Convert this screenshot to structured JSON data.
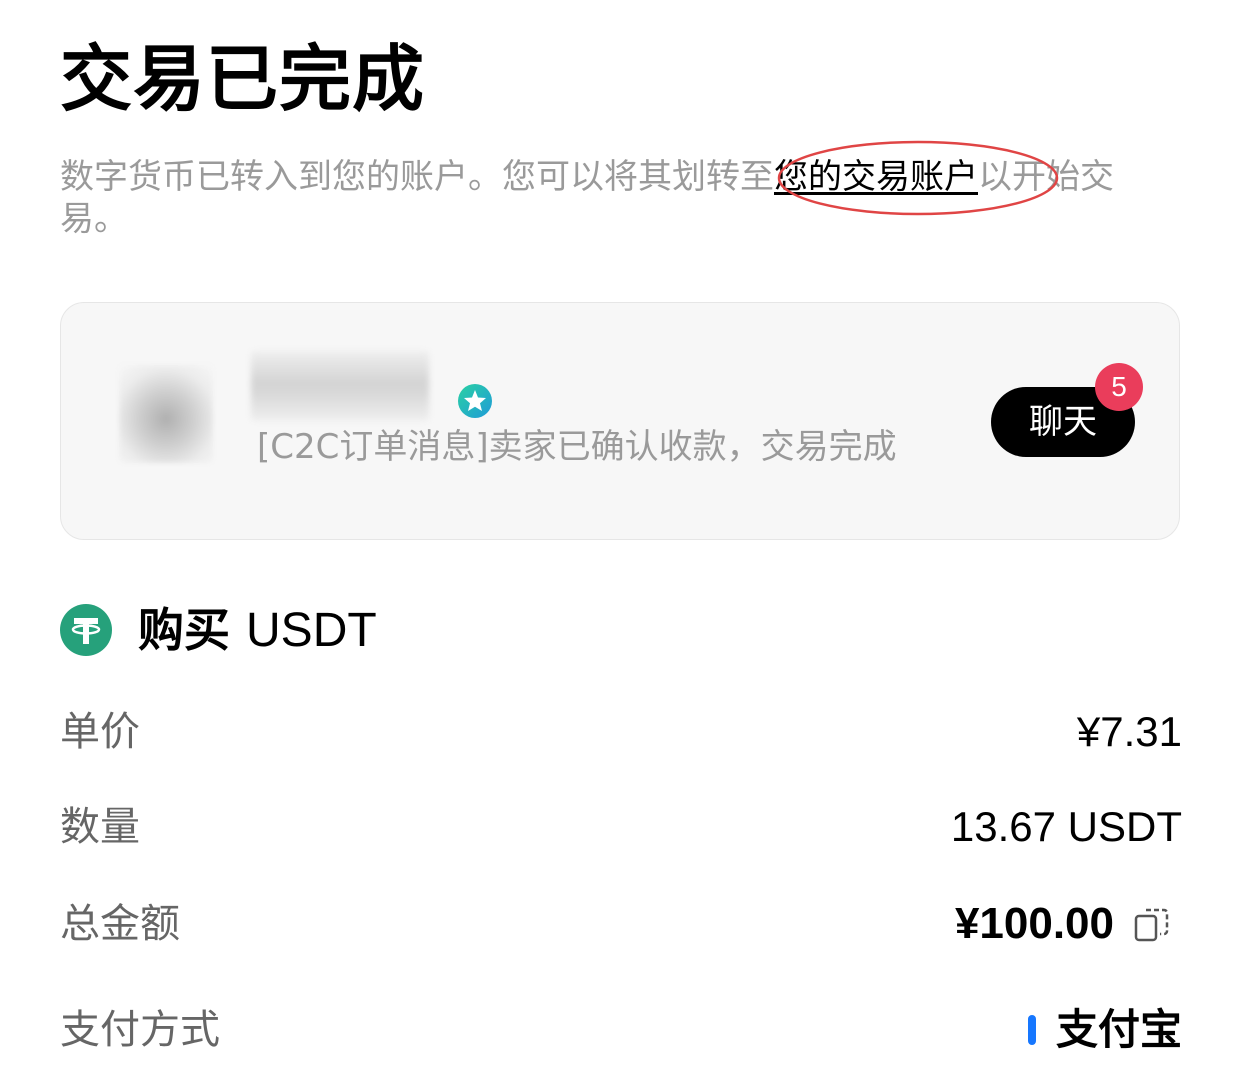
{
  "header": {
    "title": "交易已完成",
    "notice_before": "数字货币已转入到您的账户。您可以将其划转至",
    "notice_link": "您的交易账户",
    "notice_after": "以开始交易。"
  },
  "chat_card": {
    "message": "[C2C订单消息]卖家已确认收款，交易完成",
    "chat_button_label": "聊天",
    "unread_count": "5",
    "verified_icon": "verified-star-icon"
  },
  "order": {
    "title_action": "购买",
    "title_asset": "USDT",
    "coin_icon": "usdt-coin-icon",
    "rows": {
      "unit_price": {
        "label": "单价",
        "value": "¥7.31"
      },
      "quantity": {
        "label": "数量",
        "value": "13.67 USDT"
      },
      "total": {
        "label": "总金额",
        "value": "¥100.00"
      },
      "payment": {
        "label": "支付方式",
        "value": "支付宝"
      }
    }
  },
  "colors": {
    "primary_text": "#000000",
    "secondary_text": "#9a9a9a",
    "label_text": "#666666",
    "card_bg": "#f7f7f7",
    "badge_red": "#ea3d5b",
    "annotation_red": "#e04545",
    "usdt_green": "#26a17b",
    "alipay_blue": "#1677ff"
  }
}
